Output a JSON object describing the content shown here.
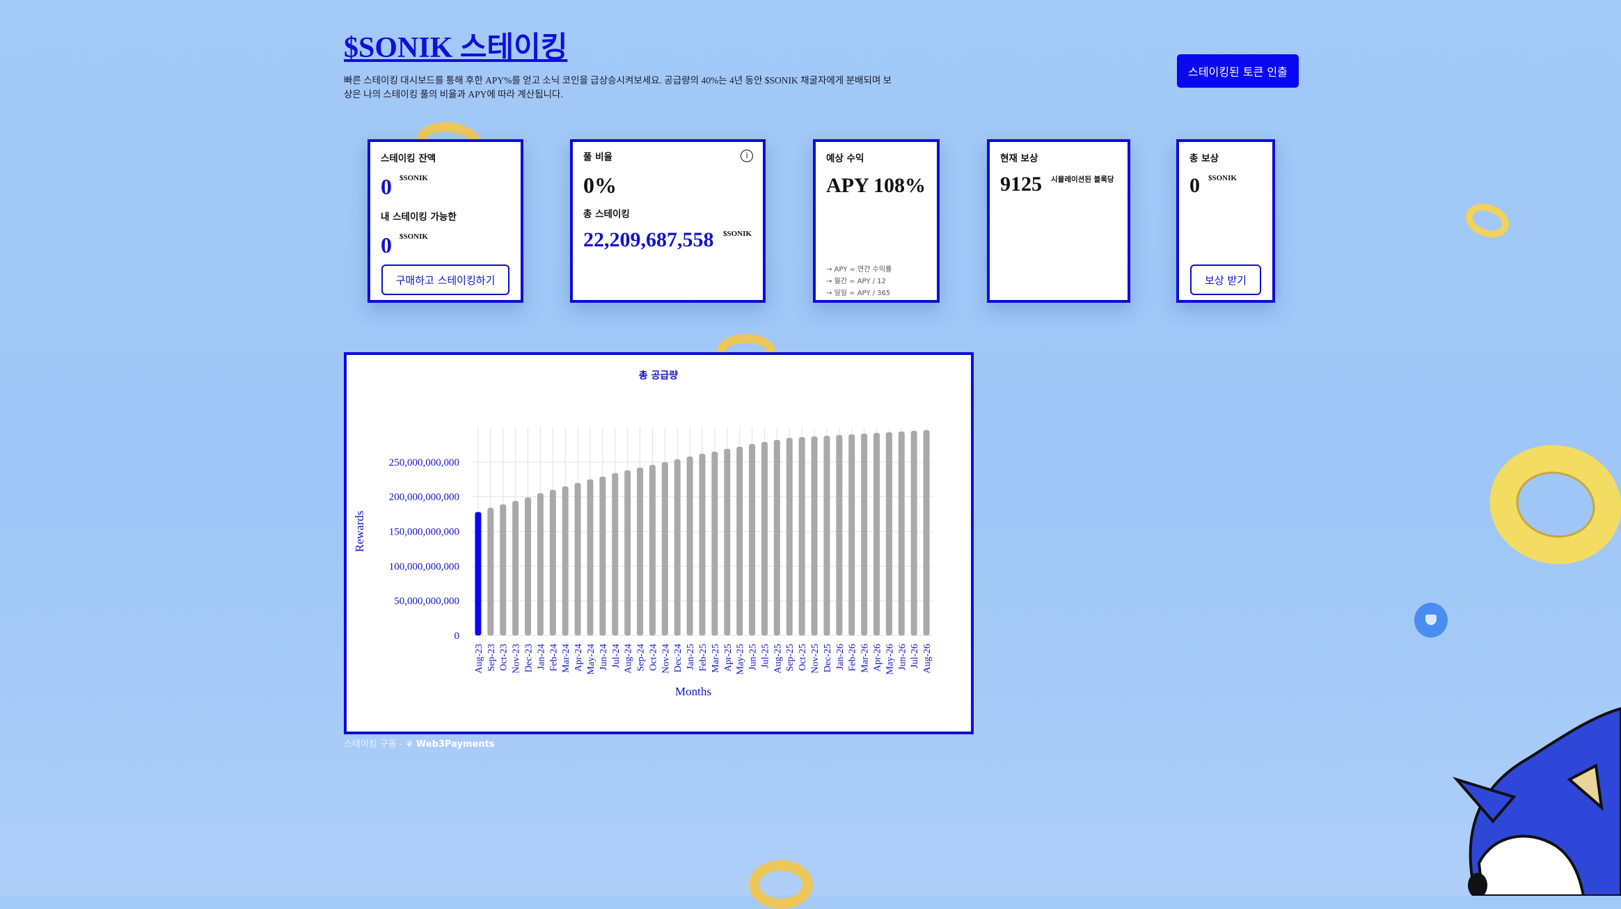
{
  "header": {
    "title": "$SONIK 스테이킹",
    "description": "빠른 스테이킹 대시보드를 통해 후한 APY%를 얻고 소닉 코인을 급상승시켜보세요. 공급량의 40%는 4년 동안 $SONIK 채굴자에게 분배되며 보상은 나의 스테이킹 풀의 비율과 APY에 따라 계산됩니다.",
    "withdraw_button": "스테이킹된 토큰 인출"
  },
  "cards": {
    "balance": {
      "label": "스테이킹 잔액",
      "value": "0",
      "unit": "$SONIK",
      "available_label": "내 스테이킹 가능한",
      "available_value": "0",
      "available_unit": "$SONIK",
      "button": "구매하고 스테이킹하기"
    },
    "pool": {
      "label": "풀 비율",
      "value": "0%",
      "total_label": "총 스테이킹",
      "total_value": "22,209,687,558",
      "total_unit": "$SONIK",
      "info_icon": "info-icon"
    },
    "earnings": {
      "label": "예상 수익",
      "value": "APY 108%",
      "notes": [
        "→ APY = 연간 수익률",
        "→ 월간 = APY / 12",
        "→ 일일 = APY / 365"
      ]
    },
    "current_reward": {
      "label": "현재 보상",
      "value": "9125",
      "unit": "시뮬레이션된 블록당"
    },
    "total_reward": {
      "label": "총 보상",
      "value": "0",
      "unit": "$SONIK",
      "button": "보상 받기"
    }
  },
  "footer": {
    "prefix": "스테이킹 구동 - ",
    "brand": "Web3Payments"
  },
  "colors": {
    "accent": "#0d0dd6",
    "bar_default": "#a9a9a9",
    "bar_highlight": "#0a08f0",
    "background": "#a3c9f7"
  },
  "chart_data": {
    "type": "bar",
    "title": "총 공급량",
    "xlabel": "Months",
    "ylabel": "Rewards",
    "ylim": [
      0,
      300000000000
    ],
    "yticks": [
      0,
      50000000000,
      100000000000,
      150000000000,
      200000000000,
      250000000000
    ],
    "ytick_labels": [
      "0",
      "50,000,000,000",
      "100,000,000,000",
      "150,000,000,000",
      "200,000,000,000",
      "250,000,000,000"
    ],
    "grid": true,
    "highlight_index": 0,
    "categories": [
      "Aug-23",
      "Sep-23",
      "Oct-23",
      "Nov-23",
      "Dec-23",
      "Jan-24",
      "Feb-24",
      "Mar-24",
      "Apr-24",
      "May-24",
      "Jun-24",
      "Jul-24",
      "Aug-24",
      "Sep-24",
      "Oct-24",
      "Nov-24",
      "Dec-24",
      "Jan-25",
      "Feb-25",
      "Mar-25",
      "Apr-25",
      "May-25",
      "Jun-25",
      "Jul-25",
      "Aug-25",
      "Sep-25",
      "Oct-25",
      "Nov-25",
      "Dec-25",
      "Jan-26",
      "Feb-26",
      "Mar-26",
      "Apr-26",
      "May-26",
      "Jun-26",
      "Jul-26",
      "Aug-26"
    ],
    "values": [
      178000000000,
      184000000000,
      189000000000,
      194000000000,
      199000000000,
      205000000000,
      210000000000,
      215000000000,
      220000000000,
      225000000000,
      229000000000,
      234000000000,
      238000000000,
      242000000000,
      246000000000,
      250000000000,
      254000000000,
      258000000000,
      262000000000,
      265000000000,
      269000000000,
      272000000000,
      276000000000,
      279000000000,
      282000000000,
      285000000000,
      286000000000,
      287000000000,
      288000000000,
      289000000000,
      290000000000,
      291000000000,
      292000000000,
      293000000000,
      294000000000,
      295000000000,
      296000000000
    ]
  }
}
